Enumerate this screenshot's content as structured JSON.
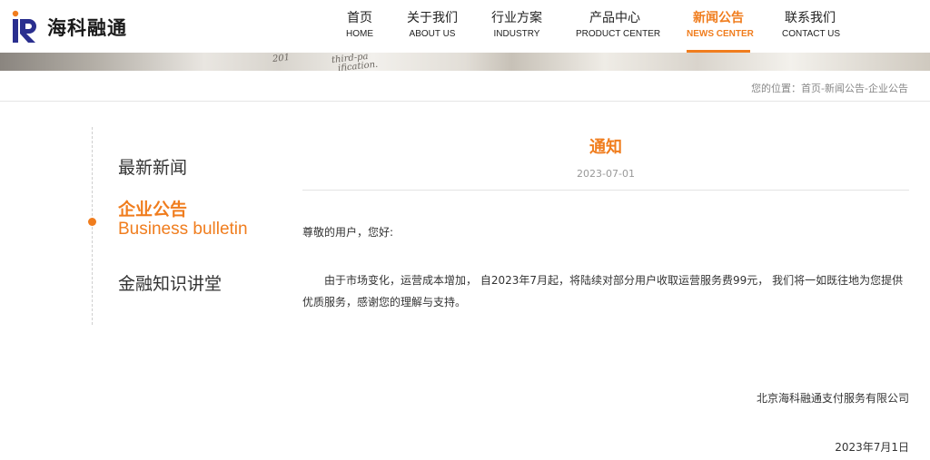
{
  "brand": {
    "name": "海科融通",
    "logo_letters": "iR",
    "accent_color": "#f07d1e",
    "logo_blue": "#2a2f8f"
  },
  "nav": {
    "items": [
      {
        "cn": "首页",
        "en": "HOME"
      },
      {
        "cn": "关于我们",
        "en": "ABOUT US"
      },
      {
        "cn": "行业方案",
        "en": "INDUSTRY"
      },
      {
        "cn": "产品中心",
        "en": "PRODUCT CENTER"
      },
      {
        "cn": "新闻公告",
        "en": "NEWS CENTER",
        "active": true
      },
      {
        "cn": "联系我们",
        "en": "CONTACT US"
      }
    ]
  },
  "banner": {
    "text_a": "third-pa",
    "text_b": "ification.",
    "text_c": "201"
  },
  "breadcrumb": {
    "text": "您的位置：首页-新闻公告-企业公告"
  },
  "sidebar": {
    "items": [
      {
        "cn": "最新新闻"
      },
      {
        "cn": "企业公告",
        "en": "Business bulletin",
        "active": true
      },
      {
        "cn": "金融知识讲堂"
      }
    ]
  },
  "article": {
    "title": "通知",
    "date": "2023-07-01",
    "greeting": "尊敬的用户，您好:",
    "body": "由于市场变化，运营成本增加， 自2023年7月起，将陆续对部分用户收取运营服务费99元， 我们将一如既往地为您提供优质服务，感谢您的理解与支持。",
    "signature": "北京海科融通支付服务有限公司",
    "sign_date": "2023年7月1日"
  }
}
